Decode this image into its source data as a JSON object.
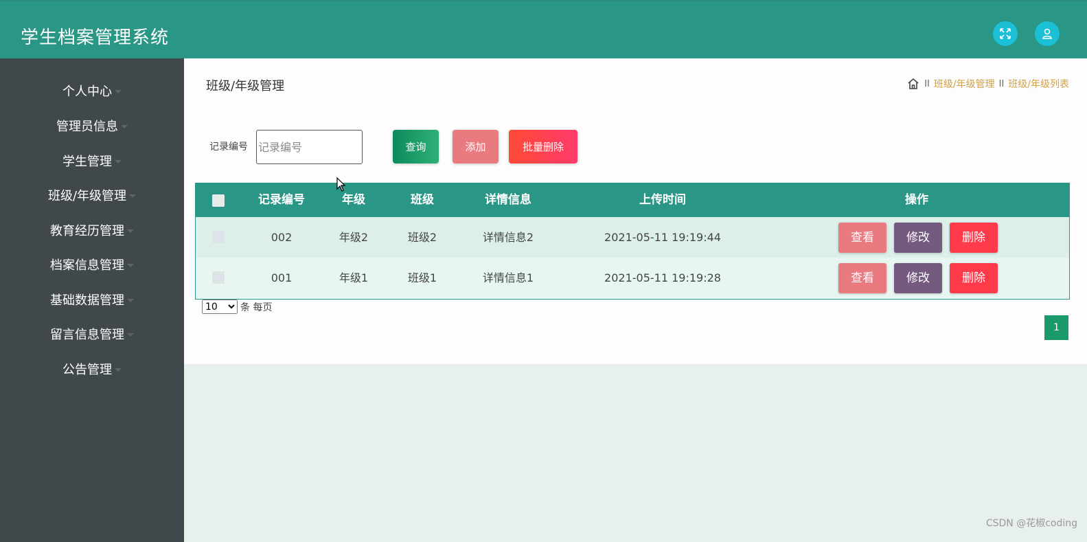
{
  "app": {
    "title": "学生档案管理系统"
  },
  "header_icons": {
    "expand": "expand-icon",
    "user": "user-icon"
  },
  "sidebar": {
    "items": [
      {
        "label": "个人中心"
      },
      {
        "label": "管理员信息"
      },
      {
        "label": "学生管理"
      },
      {
        "label": "班级/年级管理"
      },
      {
        "label": "教育经历管理"
      },
      {
        "label": "档案信息管理"
      },
      {
        "label": "基础数据管理"
      },
      {
        "label": "留言信息管理"
      },
      {
        "label": "公告管理"
      }
    ]
  },
  "page": {
    "title": "班级/年级管理",
    "breadcrumb": {
      "sep": "II",
      "item1": "班级/年级管理",
      "item2": "班级/年级列表"
    }
  },
  "search": {
    "label": "记录编号",
    "placeholder": "记录编号",
    "query_label": "查询",
    "add_label": "添加",
    "batch_delete_label": "批量删除"
  },
  "table": {
    "headers": [
      "记录编号",
      "年级",
      "班级",
      "详情信息",
      "上传时间",
      "操作"
    ],
    "rows": [
      {
        "id": "002",
        "grade": "年级2",
        "class": "班级2",
        "detail": "详情信息2",
        "time": "2021-05-11 19:19:44"
      },
      {
        "id": "001",
        "grade": "年级1",
        "class": "班级1",
        "detail": "详情信息1",
        "time": "2021-05-11 19:19:28"
      }
    ],
    "actions": {
      "view": "查看",
      "edit": "修改",
      "delete": "删除"
    }
  },
  "pagination": {
    "page_size": "10",
    "page_size_suffix": "条 每页",
    "current_page": "1"
  },
  "watermark": "CSDN @花椒coding",
  "colors": {
    "primary": "#2a9685",
    "sidebar": "#41484c",
    "view": "#e87a80",
    "edit": "#735a7e",
    "delete": "#ff3a4a"
  }
}
